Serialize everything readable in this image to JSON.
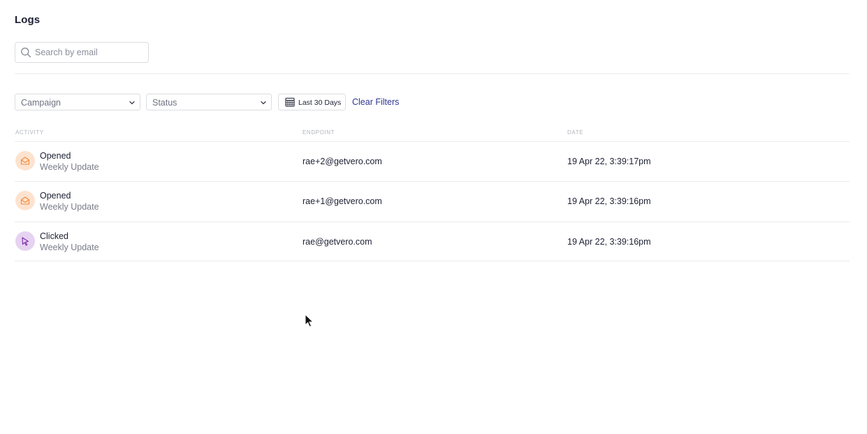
{
  "page": {
    "title": "Logs"
  },
  "search": {
    "placeholder": "Search by email",
    "value": ""
  },
  "filters": {
    "campaign_label": "Campaign",
    "status_label": "Status",
    "date_range_label": "Last 30 Days",
    "clear_label": "Clear Filters"
  },
  "table": {
    "columns": [
      "Activity",
      "Endpoint",
      "Date"
    ],
    "rows": [
      {
        "activity": "Opened",
        "subject": "Weekly Update",
        "endpoint": "rae+2@getvero.com",
        "date": "19 Apr 22, 3:39:17pm",
        "icon": "envelope-open-icon"
      },
      {
        "activity": "Opened",
        "subject": "Weekly Update",
        "endpoint": "rae+1@getvero.com",
        "date": "19 Apr 22, 3:39:16pm",
        "icon": "envelope-open-icon"
      },
      {
        "activity": "Clicked",
        "subject": "Weekly Update",
        "endpoint": "rae@getvero.com",
        "date": "19 Apr 22, 3:39:16pm",
        "icon": "cursor-click-icon"
      }
    ]
  },
  "colors": {
    "opened_bg": "#fde3cf",
    "opened_fg": "#f08a3c",
    "clicked_bg": "#e6d2f1",
    "clicked_fg": "#7a2aa6",
    "link": "#2d3594"
  }
}
